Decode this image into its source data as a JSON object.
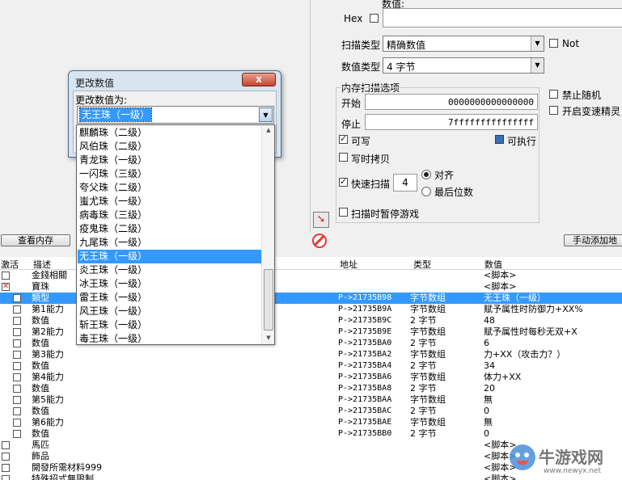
{
  "top_panel": {
    "value_label": "数值:",
    "hex_label": "Hex",
    "scan_type_label": "扫描类型",
    "scan_type_value": "精确数值",
    "value_type_label": "数值类型",
    "value_type_value": "4 字节",
    "not_label": "Not",
    "mem_options_label": "内存扫描选项",
    "start_label": "开始",
    "start_value": "0000000000000000",
    "stop_label": "停止",
    "stop_value": "7fffffffffffffff",
    "writable_label": "可写",
    "executable_label": "可执行",
    "copy_on_write_label": "写时拷贝",
    "fast_scan_label": "快速扫描",
    "fast_scan_value": "4",
    "align_label": "对齐",
    "last_digits_label": "最后位数",
    "pause_game_label": "扫描时暂停游戏",
    "disable_random_label": "禁止随机",
    "speedhack_label": "开启变速精灵",
    "view_memory_button": "查看内存",
    "add_manual_button": "手动添加地"
  },
  "dialog": {
    "title": "更改数值",
    "close_label": "x",
    "prompt": "更改数值为:",
    "selected_value": "无王珠（一级）",
    "options": [
      "麒麟珠（二级）",
      "风伯珠（二级）",
      "青龙珠（一级）",
      "一闪珠（三级）",
      "夸父珠（二级）",
      "蚩尤珠（一级）",
      "病毒珠（三级）",
      "疫鬼珠（二级）",
      "九尾珠（一级）",
      "无王珠（一级）",
      "炎王珠（一级）",
      "冰王珠（一级）",
      "雷王珠（一级）",
      "风王珠（一级）",
      "斩王珠（一级）",
      "毒王珠（一级）"
    ],
    "selected_index": 9
  },
  "list": {
    "headers": {
      "active": "激活",
      "desc": "描述",
      "address": "地址",
      "type": "类型",
      "value": "数值"
    },
    "rows": [
      {
        "indent": 0,
        "box": "empty",
        "desc": "金錢相關",
        "address": "",
        "type": "",
        "value": "<脚本>"
      },
      {
        "indent": 0,
        "box": "x",
        "desc": "寶珠",
        "address": "",
        "type": "",
        "value": "<脚本>"
      },
      {
        "indent": 1,
        "box": "empty",
        "desc": "類型",
        "address": "P->21735B98",
        "type": "字节数组",
        "value": "无王珠（一级）",
        "selected": true
      },
      {
        "indent": 1,
        "box": "empty",
        "desc": "第1能力",
        "address": "P->21735B9A",
        "type": "字节数组",
        "value": "赋予属性时防御力+XX%"
      },
      {
        "indent": 1,
        "box": "empty",
        "desc": "数值",
        "address": "P->21735B9C",
        "type": "2 字节",
        "value": "48"
      },
      {
        "indent": 1,
        "box": "empty",
        "desc": "第2能力",
        "address": "P->21735B9E",
        "type": "字节数组",
        "value": "赋予属性时每秒无双+X"
      },
      {
        "indent": 1,
        "box": "empty",
        "desc": "数值",
        "address": "P->21735BA0",
        "type": "2 字节",
        "value": "6"
      },
      {
        "indent": 1,
        "box": "empty",
        "desc": "第3能力",
        "address": "P->21735BA2",
        "type": "字节数组",
        "value": "力+XX（攻击力？）"
      },
      {
        "indent": 1,
        "box": "empty",
        "desc": "数值",
        "address": "P->21735BA4",
        "type": "2 字节",
        "value": "34"
      },
      {
        "indent": 1,
        "box": "empty",
        "desc": "第4能力",
        "address": "P->21735BA6",
        "type": "字节数组",
        "value": "体力+XX"
      },
      {
        "indent": 1,
        "box": "empty",
        "desc": "数值",
        "address": "P->21735BA8",
        "type": "2 字节",
        "value": "20"
      },
      {
        "indent": 1,
        "box": "empty",
        "desc": "第5能力",
        "address": "P->21735BAA",
        "type": "字节数组",
        "value": "無"
      },
      {
        "indent": 1,
        "box": "empty",
        "desc": "数值",
        "address": "P->21735BAC",
        "type": "2 字节",
        "value": "0"
      },
      {
        "indent": 1,
        "box": "empty",
        "desc": "第6能力",
        "address": "P->21735BAE",
        "type": "字节数组",
        "value": "無"
      },
      {
        "indent": 1,
        "box": "empty",
        "desc": "数值",
        "address": "P->21735BB0",
        "type": "2 字节",
        "value": "0"
      },
      {
        "indent": 0,
        "box": "empty",
        "desc": "馬匹",
        "address": "",
        "type": "",
        "value": "<脚本>"
      },
      {
        "indent": 0,
        "box": "empty",
        "desc": "飾品",
        "address": "",
        "type": "",
        "value": "<脚本>"
      },
      {
        "indent": 0,
        "box": "empty",
        "desc": "開發所需材料999",
        "address": "",
        "type": "",
        "value": "<脚本>"
      },
      {
        "indent": 0,
        "box": "empty",
        "desc": "特殊招式無限制",
        "address": "",
        "type": "",
        "value": "<脚本>"
      }
    ]
  },
  "watermark": {
    "text": "牛游戏网",
    "url": "www.newyx.net"
  },
  "colors": {
    "selection": "#3399ff",
    "accent": "#e53935"
  }
}
